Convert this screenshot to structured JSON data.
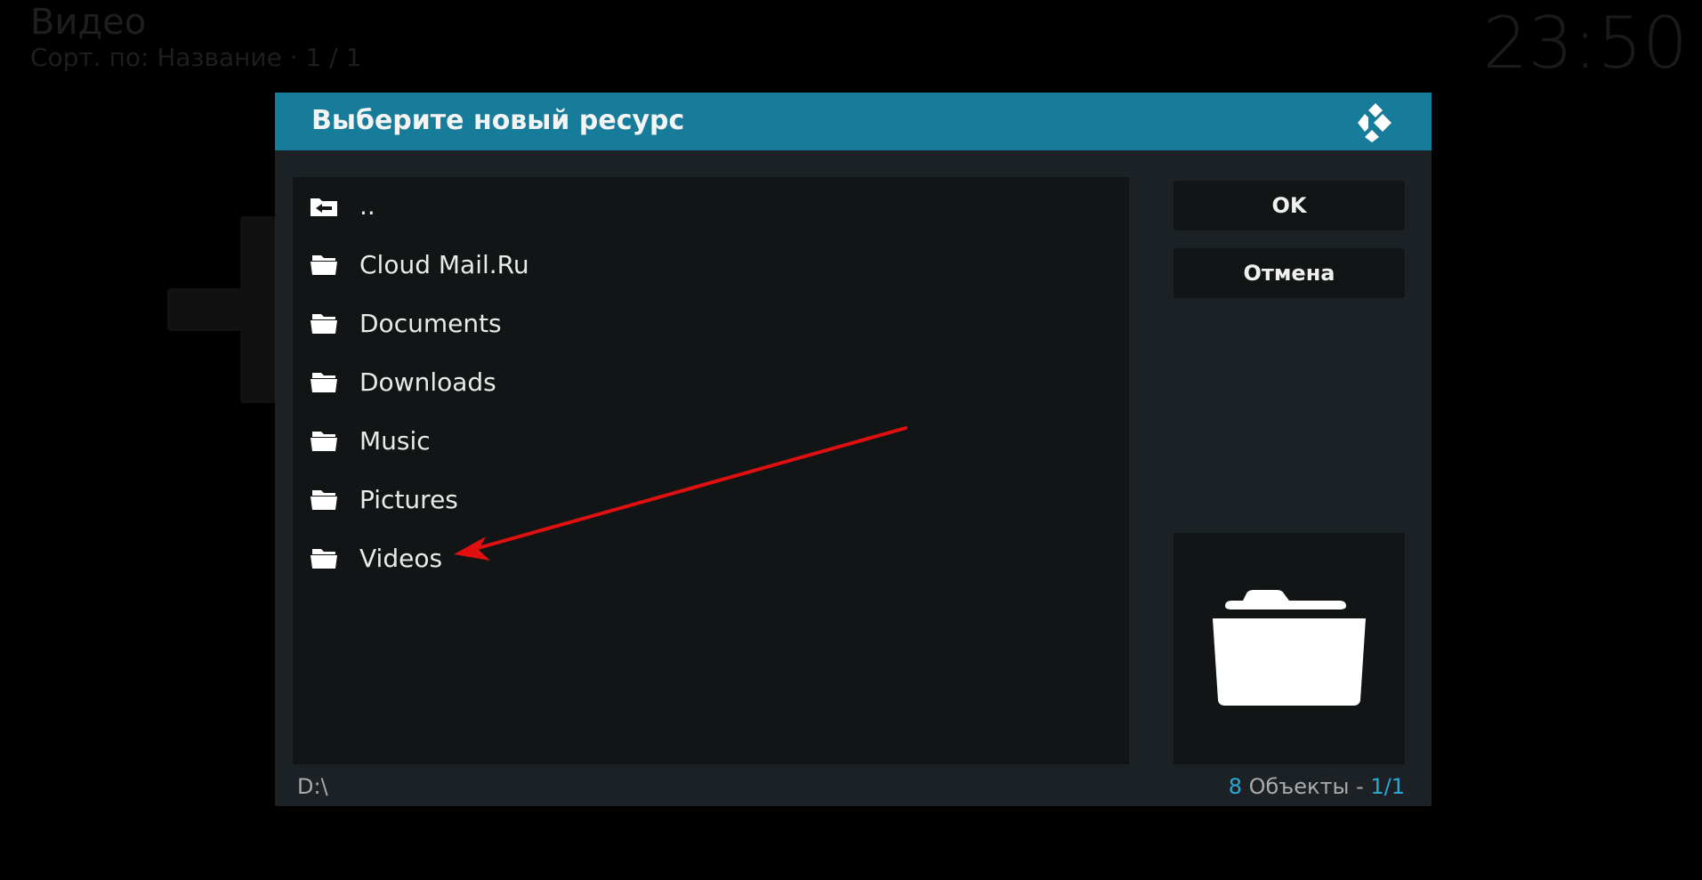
{
  "background": {
    "title": "Видео",
    "subtitle": "Сорт. по: Название  ·  1 / 1",
    "clock": "23:50"
  },
  "dialog": {
    "title": "Выберите новый ресурс",
    "items": [
      {
        "label": "..",
        "icon": "back-folder-icon"
      },
      {
        "label": "Cloud Mail.Ru",
        "icon": "folder-icon"
      },
      {
        "label": "Documents",
        "icon": "folder-icon"
      },
      {
        "label": "Downloads",
        "icon": "folder-icon"
      },
      {
        "label": "Music",
        "icon": "folder-icon"
      },
      {
        "label": "Pictures",
        "icon": "folder-icon"
      },
      {
        "label": "Videos",
        "icon": "folder-icon"
      }
    ],
    "ok_label": "OK",
    "cancel_label": "Отмена",
    "path": "D:\\",
    "count_number": "8",
    "count_text": " Объекты - ",
    "count_page": "1/1"
  },
  "colors": {
    "header": "#167c9a",
    "accent": "#2aa8d6",
    "annotation_arrow": "#e01010"
  }
}
